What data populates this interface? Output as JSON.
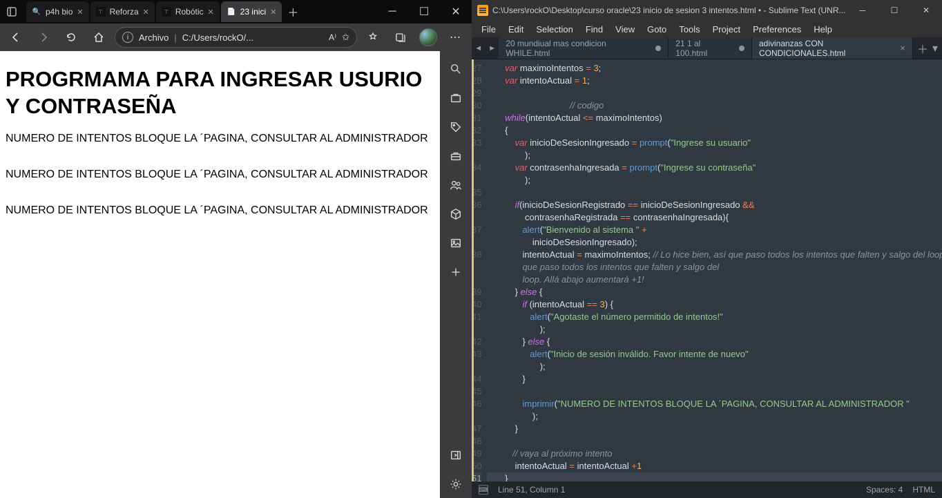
{
  "edge": {
    "tabs": [
      {
        "favicon": "🔍",
        "title": "p4h bio",
        "active": false
      },
      {
        "favicon": "∎",
        "title": "Reforza",
        "active": false
      },
      {
        "favicon": "∎",
        "title": "Robótic",
        "active": false
      },
      {
        "favicon": "📄",
        "title": "23 inici",
        "active": true
      }
    ],
    "address": {
      "label": "Archivo",
      "url": "C:/Users/rockO/..."
    },
    "page": {
      "heading": "PROGRMAMA PARA INGRESAR USURIO Y CONTRASEÑA",
      "line": "NUMERO DE INTENTOS BLOQUE LA ´PAGINA, CONSULTAR AL ADMINISTRADOR"
    },
    "side_icons": [
      "search",
      "briefcase",
      "tag",
      "cart",
      "people",
      "cube",
      "image",
      "plus",
      "panel",
      "gear"
    ]
  },
  "sublime": {
    "title": "C:\\Users\\rockO\\Desktop\\curso oracle\\23 inicio de sesion 3 intentos.html • - Sublime Text (UNR...",
    "menu": [
      "File",
      "Edit",
      "Selection",
      "Find",
      "View",
      "Goto",
      "Tools",
      "Project",
      "Preferences",
      "Help"
    ],
    "tabs": [
      {
        "title": "20 mundiual mas condicion WHILE.html",
        "dirty": true,
        "active": false
      },
      {
        "title": "21 1 al 100.html",
        "dirty": true,
        "active": false
      },
      {
        "title": "adivinanzas CON CONDICIONALES.html",
        "dirty": false,
        "active": true
      }
    ],
    "lines_start": 27,
    "lines_end": 51,
    "current_line": 51,
    "status": {
      "pos": "Line 51, Column 1",
      "spaces": "Spaces: 4",
      "syntax": "HTML"
    },
    "code": {
      "l27": {
        "a": "var",
        "b": "maximoIntentos",
        "c": "=",
        "d": "3",
        "e": ";"
      },
      "l28": {
        "a": "var",
        "b": "intentoActual",
        "c": "=",
        "d": "1",
        "e": ";"
      },
      "l30": {
        "a": "// codigo"
      },
      "l31": {
        "a": "while",
        "b": "(intentoActual",
        "c": "<=",
        "d": "maximoIntentos)"
      },
      "l32": {
        "a": "{"
      },
      "l33": {
        "a": "var",
        "b": "inicioDeSesionIngresado",
        "c": "=",
        "d": "prompt",
        "e": "(",
        "f": "\"Ingrese su usuario\"",
        "g": ");"
      },
      "l34": {
        "a": "var",
        "b": "contrasenhaIngresada",
        "c": "=",
        "d": "prompt",
        "e": "(",
        "f": "\"Ingrese su contraseña\"",
        "g": ");"
      },
      "l36": {
        "a": "if",
        "b": "(inicioDeSesionRegistrado",
        "c": "==",
        "d": "inicioDeSesionIngresado",
        "e": "&&",
        "f": "contrasenhaRegistrada",
        "g": "==",
        "h": "contrasenhaIngresada){"
      },
      "l37": {
        "a": "alert",
        "b": "(",
        "c": "\"Bienvenido al sistema \"",
        "d": "+",
        "e": "inicioDeSesionIngresado);"
      },
      "l38": {
        "a": "intentoActual",
        "b": "=",
        "c": "maximoIntentos;",
        "d": "// Lo hice bien, así que paso todos los intentos que falten y salgo del loop. Allá abajo aumentará +1!"
      },
      "l39": {
        "a": "}",
        "b": "else",
        "c": "{"
      },
      "l40": {
        "a": "if",
        "b": "(intentoActual",
        "c": "==",
        "d": "3",
        "e": ") {"
      },
      "l41": {
        "a": "alert",
        "b": "(",
        "c": "\"Agotaste el número permitido de intentos!\"",
        "d": ");"
      },
      "l42": {
        "a": "}",
        "b": "else",
        "c": "{"
      },
      "l43": {
        "a": "alert",
        "b": "(",
        "c": "\"Inicio de sesión inválido. Favor intente de nuevo\"",
        "d": ");"
      },
      "l44": {
        "a": "}"
      },
      "l46": {
        "a": "imprimir",
        "b": "(",
        "c": "\"NUMERO DE INTENTOS BLOQUE LA ´PAGINA, CONSULTAR AL ADMINISTRADOR \"",
        "d": ");"
      },
      "l47": {
        "a": "}"
      },
      "l49": {
        "a": "// vaya al próximo intento"
      },
      "l50": {
        "a": "intentoActual",
        "b": "=",
        "c": "intentoActual",
        "d": "+",
        "e": "1"
      },
      "l51": {
        "a": "}"
      }
    }
  }
}
